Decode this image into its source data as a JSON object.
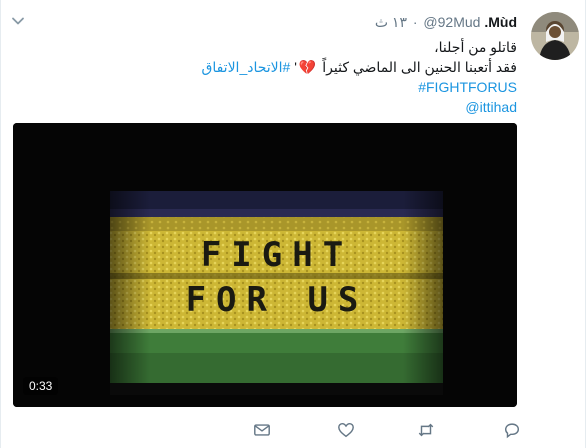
{
  "header": {
    "fullname": "Mùd.",
    "username": "@92Mud",
    "separator": "·",
    "time": "١٣ ث"
  },
  "tweet": {
    "line1": "قاتلو من أجلنا،",
    "line2_text": "فقد أتعبنا الحنين الى الماضي كثيراً",
    "line2_heart": "💔",
    "line2_quote": "'",
    "line2_hashtag": "#الاتحاد_الاتفاق",
    "line3_hashtag": "#FIGHTFORUS",
    "line4_mention": "@ittihad"
  },
  "media": {
    "duration": "0:33",
    "banner_line1": "FIGHT",
    "banner_line2": "FOR US"
  },
  "icons": {
    "menu": "chevron-down-icon",
    "reply": "reply-icon",
    "retweet": "retweet-icon",
    "like": "heart-icon",
    "dm": "mail-icon"
  },
  "colors": {
    "link": "#1b95e0",
    "secondary": "#657786",
    "stands_yellow": "#d8c33a"
  }
}
